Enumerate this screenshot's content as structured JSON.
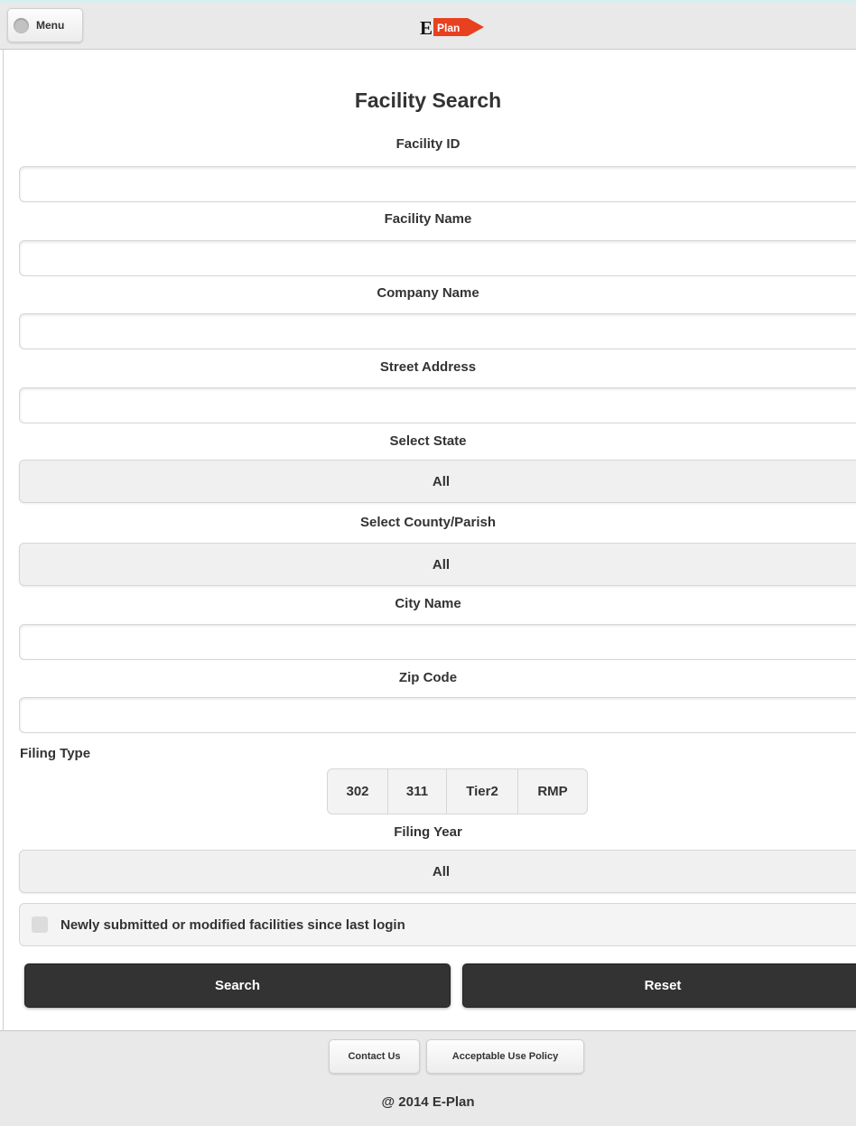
{
  "header": {
    "menu_label": "Menu",
    "logo_text": "E Plan"
  },
  "form": {
    "title": "Facility Search",
    "facility_id_label": "Facility ID",
    "facility_id_value": "",
    "facility_name_label": "Facility Name",
    "facility_name_value": "",
    "company_name_label": "Company Name",
    "company_name_value": "",
    "street_address_label": "Street Address",
    "street_address_value": "",
    "state_label": "Select State",
    "state_value": "All",
    "county_label": "Select County/Parish",
    "county_value": "All",
    "city_label": "City Name",
    "city_value": "",
    "zip_label": "Zip Code",
    "zip_value": "",
    "filing_type_label": "Filing Type",
    "filing_types": [
      "302",
      "311",
      "Tier2",
      "RMP"
    ],
    "filing_year_label": "Filing Year",
    "filing_year_value": "All",
    "newly_submitted_label": "Newly submitted or modified facilities since last login",
    "newly_submitted_checked": false,
    "search_label": "Search",
    "reset_label": "Reset"
  },
  "footer": {
    "contact_label": "Contact Us",
    "policy_label": "Acceptable Use Policy",
    "copyright": "@ 2014 E-Plan"
  },
  "colors": {
    "header_bg": "#e9e9e9",
    "button_dark": "#333333",
    "logo_red": "#e8411f"
  }
}
